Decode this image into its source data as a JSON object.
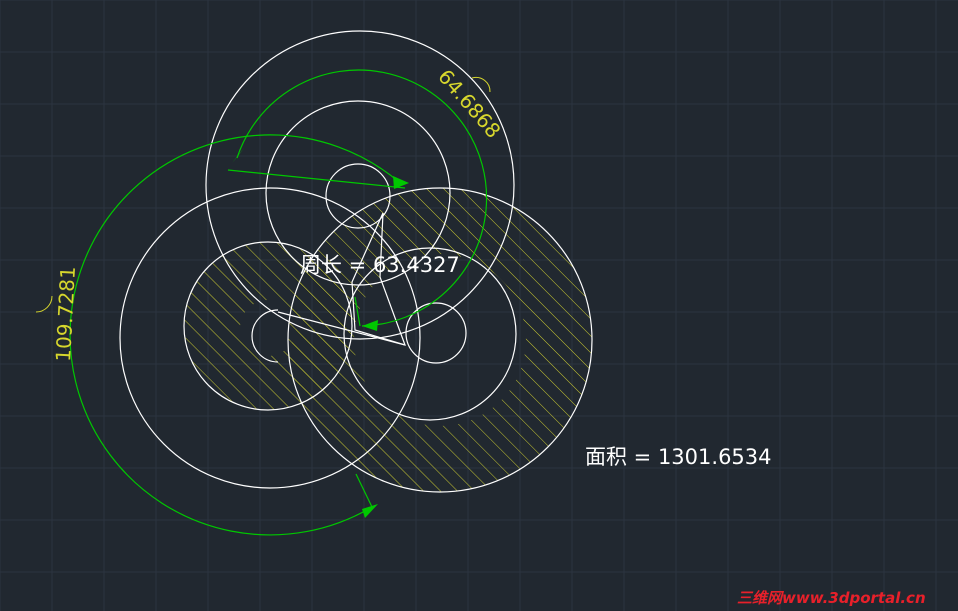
{
  "colors": {
    "background": "#212830",
    "grid": "#2c3440",
    "geometry": "#ffffff",
    "dimension": "#00c800",
    "dimension_text": "#d7d72d",
    "hatch": "#c8c832",
    "watermark": "#e8202a",
    "label": "#ffffff"
  },
  "annotations": {
    "perimeter_label": "周长 = 63.4327",
    "area_label": "面积 = 1301.6534"
  },
  "dimensions": {
    "arc_top": "64.6868",
    "arc_left": "109.7281"
  },
  "watermark": {
    "text": "三维网www.3dportal.cn"
  }
}
